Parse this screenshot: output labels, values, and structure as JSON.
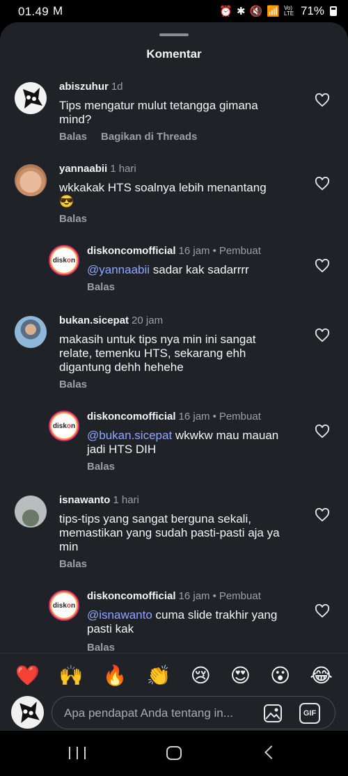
{
  "status_bar": {
    "time": "01.49",
    "mail_icon": "M",
    "signal_text": "Vo) LTE",
    "battery": "71%"
  },
  "sheet": {
    "title": "Komentar"
  },
  "comments": [
    {
      "username": "abiszuhur",
      "time": "1d",
      "text": "Tips mengatur mulut tetangga gimana mind?",
      "reply_label": "Balas",
      "share_label": "Bagikan di Threads"
    },
    {
      "username": "yannaabii",
      "time": "1 hari",
      "text": "wkkakak HTS soalnya lebih menantang 😎",
      "reply_label": "Balas"
    },
    {
      "username": "diskoncomofficial",
      "time": "16 jam",
      "badge": "Pembuat",
      "mention": "@yannaabii",
      "text": " sadar kak sadarrrr",
      "reply_label": "Balas"
    },
    {
      "username": "bukan.sicepat",
      "time": "20 jam",
      "text": "makasih untuk tips nya min ini sangat relate, temenku HTS, sekarang ehh digantung dehh hehehe",
      "reply_label": "Balas"
    },
    {
      "username": "diskoncomofficial",
      "time": "16 jam",
      "badge": "Pembuat",
      "mention": "@bukan.sicepat",
      "text": " wkwkw mau mauan jadi HTS DIH",
      "reply_label": "Balas"
    },
    {
      "username": "isnawanto",
      "time": "1 hari",
      "text": "tips-tips yang sangat berguna sekali, memastikan yang sudah pasti-pasti aja ya min",
      "reply_label": "Balas"
    },
    {
      "username": "diskoncomofficial",
      "time": "16 jam",
      "badge": "Pembuat",
      "mention": "@isnawanto",
      "text": " cuma slide trakhir yang pasti kak",
      "reply_label": "Balas"
    }
  ],
  "diskon_logo": {
    "a": "disk",
    "b": "o",
    "c": "n"
  },
  "emoji_reactions": [
    "❤️",
    "🙌",
    "🔥",
    "👏",
    "😢",
    "😍",
    "😮",
    "😂"
  ],
  "composer": {
    "placeholder": "Apa pendapat Anda tentang in...",
    "gif_label": "GIF"
  },
  "colors": {
    "sheet_bg": "#1f2328",
    "mention": "#8fa6ff",
    "muted": "#9aa0a6"
  }
}
